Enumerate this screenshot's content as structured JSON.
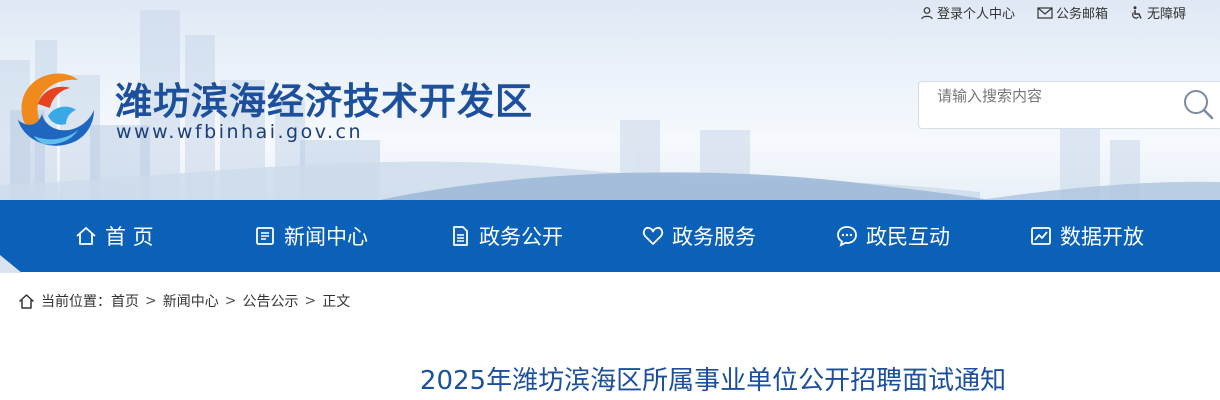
{
  "top_links": [
    {
      "label": "登录个人中心",
      "icon": "user-icon"
    },
    {
      "label": "公务邮箱",
      "icon": "mail-icon"
    },
    {
      "label": "无障碍",
      "icon": "accessibility-icon"
    }
  ],
  "site": {
    "title": "潍坊滨海经济技术开发区",
    "url": "www.wfbinhai.gov.cn"
  },
  "search": {
    "placeholder": "请输入搜索内容"
  },
  "nav": [
    {
      "label": "首 页",
      "icon": "home-icon"
    },
    {
      "label": "新闻中心",
      "icon": "newspaper-icon"
    },
    {
      "label": "政务公开",
      "icon": "document-icon"
    },
    {
      "label": "政务服务",
      "icon": "heart-icon"
    },
    {
      "label": "政民互动",
      "icon": "chat-icon"
    },
    {
      "label": "数据开放",
      "icon": "chart-icon"
    }
  ],
  "breadcrumb": {
    "prefix": "当前位置：",
    "items": [
      "首页",
      "新闻中心",
      "公告公示",
      "正文"
    ],
    "separator": ">"
  },
  "article": {
    "title": "2025年潍坊滨海区所属事业单位公开招聘面试通知"
  },
  "colors": {
    "nav_bg": "#0b61b8",
    "title_blue": "#1c4f9c"
  }
}
